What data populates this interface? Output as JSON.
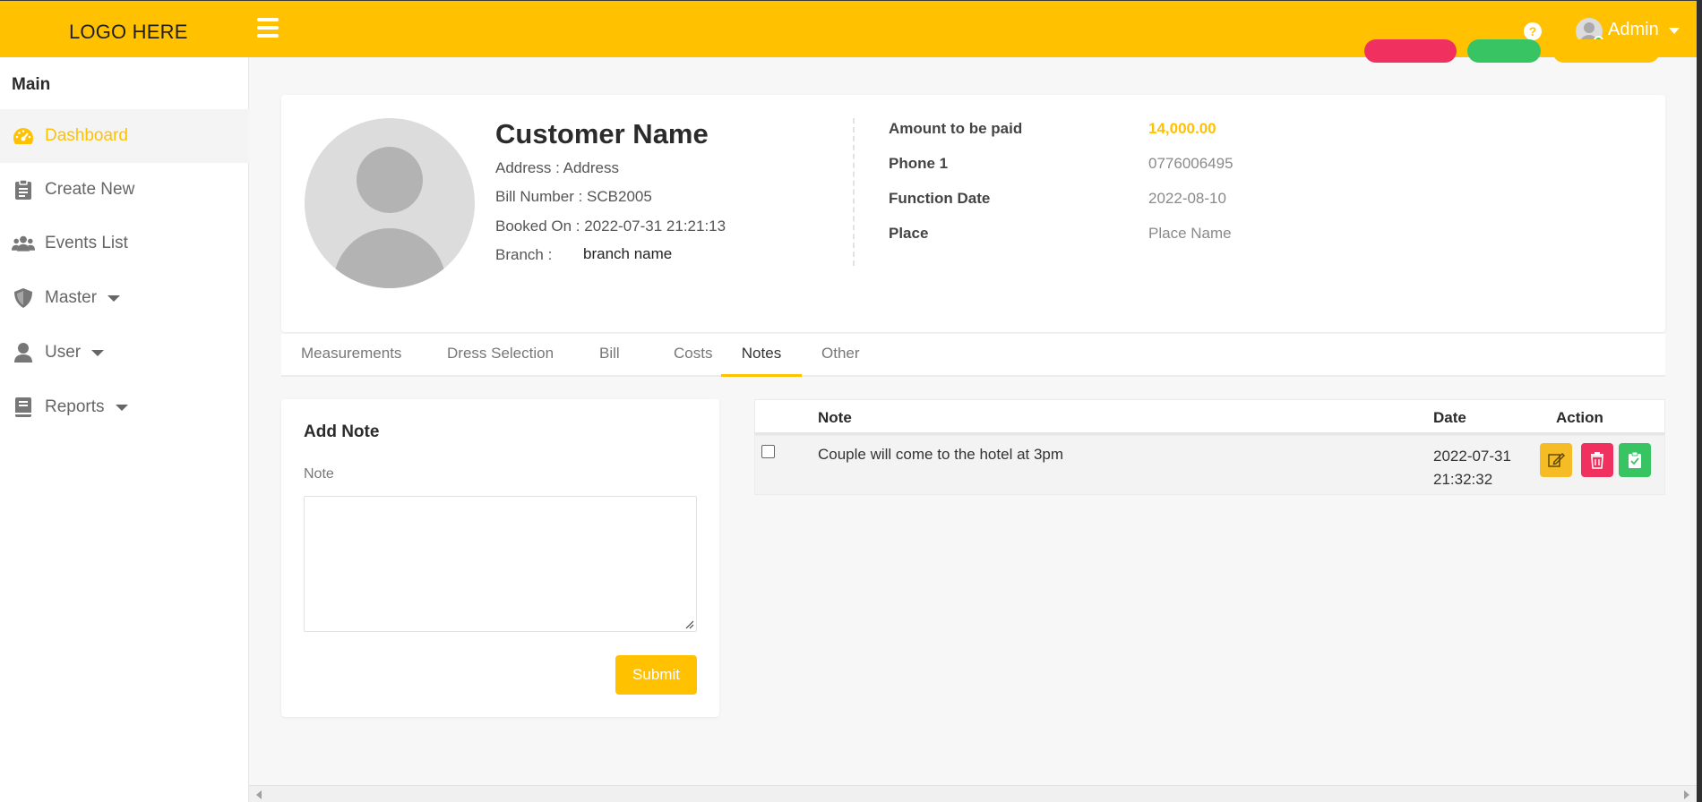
{
  "header": {
    "logo": "LOGO HERE",
    "user_name": "Admin"
  },
  "sidebar": {
    "heading": "Main",
    "items": [
      {
        "label": "Dashboard",
        "icon": "speedometer-icon",
        "active": true
      },
      {
        "label": "Create New",
        "icon": "clipboard-icon"
      },
      {
        "label": "Events List",
        "icon": "users-icon"
      },
      {
        "label": "Master",
        "icon": "shield-icon",
        "has_dropdown": true
      },
      {
        "label": "User",
        "icon": "user-icon",
        "has_dropdown": true
      },
      {
        "label": "Reports",
        "icon": "book-icon",
        "has_dropdown": true
      }
    ]
  },
  "customer": {
    "name": "Customer Name",
    "address_label": "Address : ",
    "address": "Address",
    "bill_label": "Bill Number : ",
    "bill_number": "SCB2005",
    "booked_label": "Booked On : ",
    "booked_on": "2022-07-31 21:21:13",
    "branch_label": "Branch : ",
    "branch": "branch name"
  },
  "details": [
    {
      "label": "Amount to be paid",
      "value": "14,000.00"
    },
    {
      "label": "Phone 1",
      "value": "0776006495"
    },
    {
      "label": "Function Date",
      "value": "2022-08-10"
    },
    {
      "label": "Place",
      "value": "Place Name"
    }
  ],
  "tabs": [
    {
      "label": "Measurements"
    },
    {
      "label": "Dress Selection"
    },
    {
      "label": "Bill"
    },
    {
      "label": "Costs"
    },
    {
      "label": "Notes",
      "active": true
    },
    {
      "label": "Other"
    }
  ],
  "add_note": {
    "title": "Add Note",
    "field_label": "Note",
    "value": "",
    "submit_label": "Submit"
  },
  "notes_table": {
    "columns": [
      "Note",
      "Date",
      "Action"
    ],
    "rows": [
      {
        "note": "Couple will come to the hotel at 3pm",
        "date_line1": "2022-07-31",
        "date_line2": "21:32:32"
      }
    ]
  },
  "colors": {
    "accent": "#ffc100",
    "edit": "#f5bc26",
    "delete": "#f0315f",
    "approve": "#39c464"
  }
}
